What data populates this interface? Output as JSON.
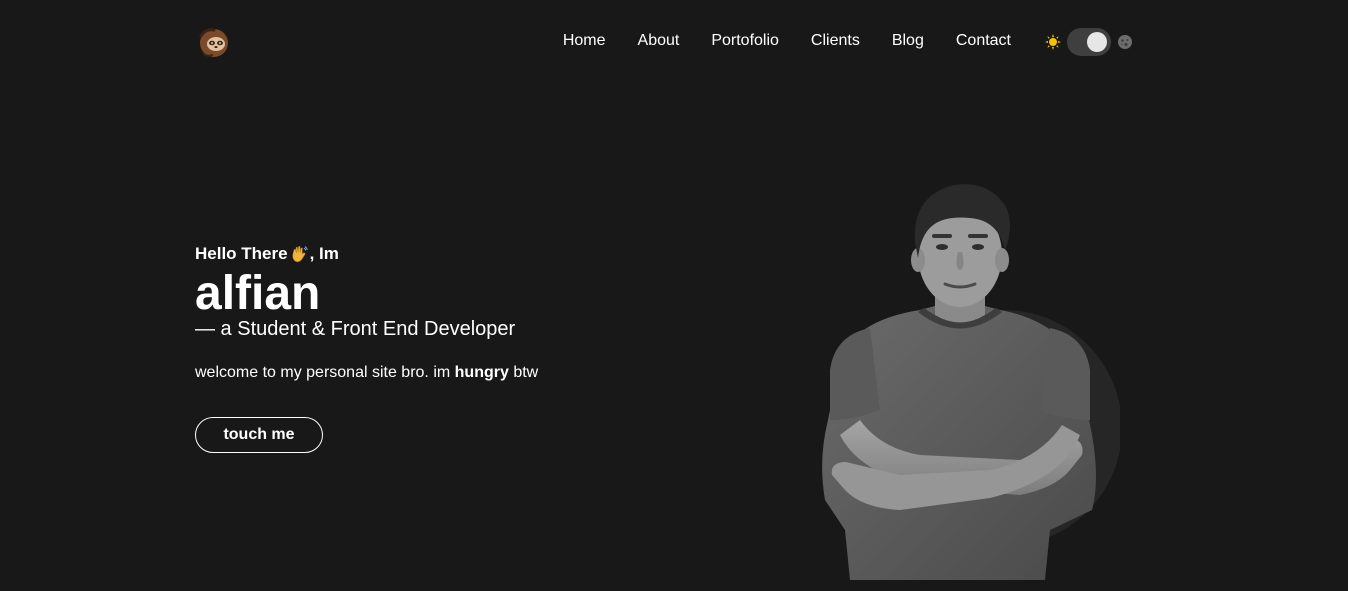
{
  "nav": {
    "logo_icon": "sloth-logo-icon",
    "items": [
      {
        "label": "Home"
      },
      {
        "label": "About"
      },
      {
        "label": "Portofolio"
      },
      {
        "label": "Clients"
      },
      {
        "label": "Blog"
      },
      {
        "label": "Contact"
      }
    ],
    "theme_toggle": {
      "left_icon": "sun-icon",
      "right_icon": "moon-icon",
      "state": "dark"
    }
  },
  "hero": {
    "greeting_before": "Hello There",
    "greeting_icon": "waving-hand-icon",
    "greeting_after": ", Im",
    "name": "alfian",
    "role": "— a Student & Front End Developer",
    "tagline_before": "welcome to my personal site bro. im ",
    "tagline_bold": "hungry",
    "tagline_after": " btw",
    "cta_label": "touch me"
  },
  "portrait": {
    "icon": "profile-photo"
  },
  "colors": {
    "background": "#181818",
    "text": "#ffffff",
    "toggle_track": "#3f3f3f",
    "toggle_knob": "#e6e6e6",
    "sun": "#f5c400"
  }
}
